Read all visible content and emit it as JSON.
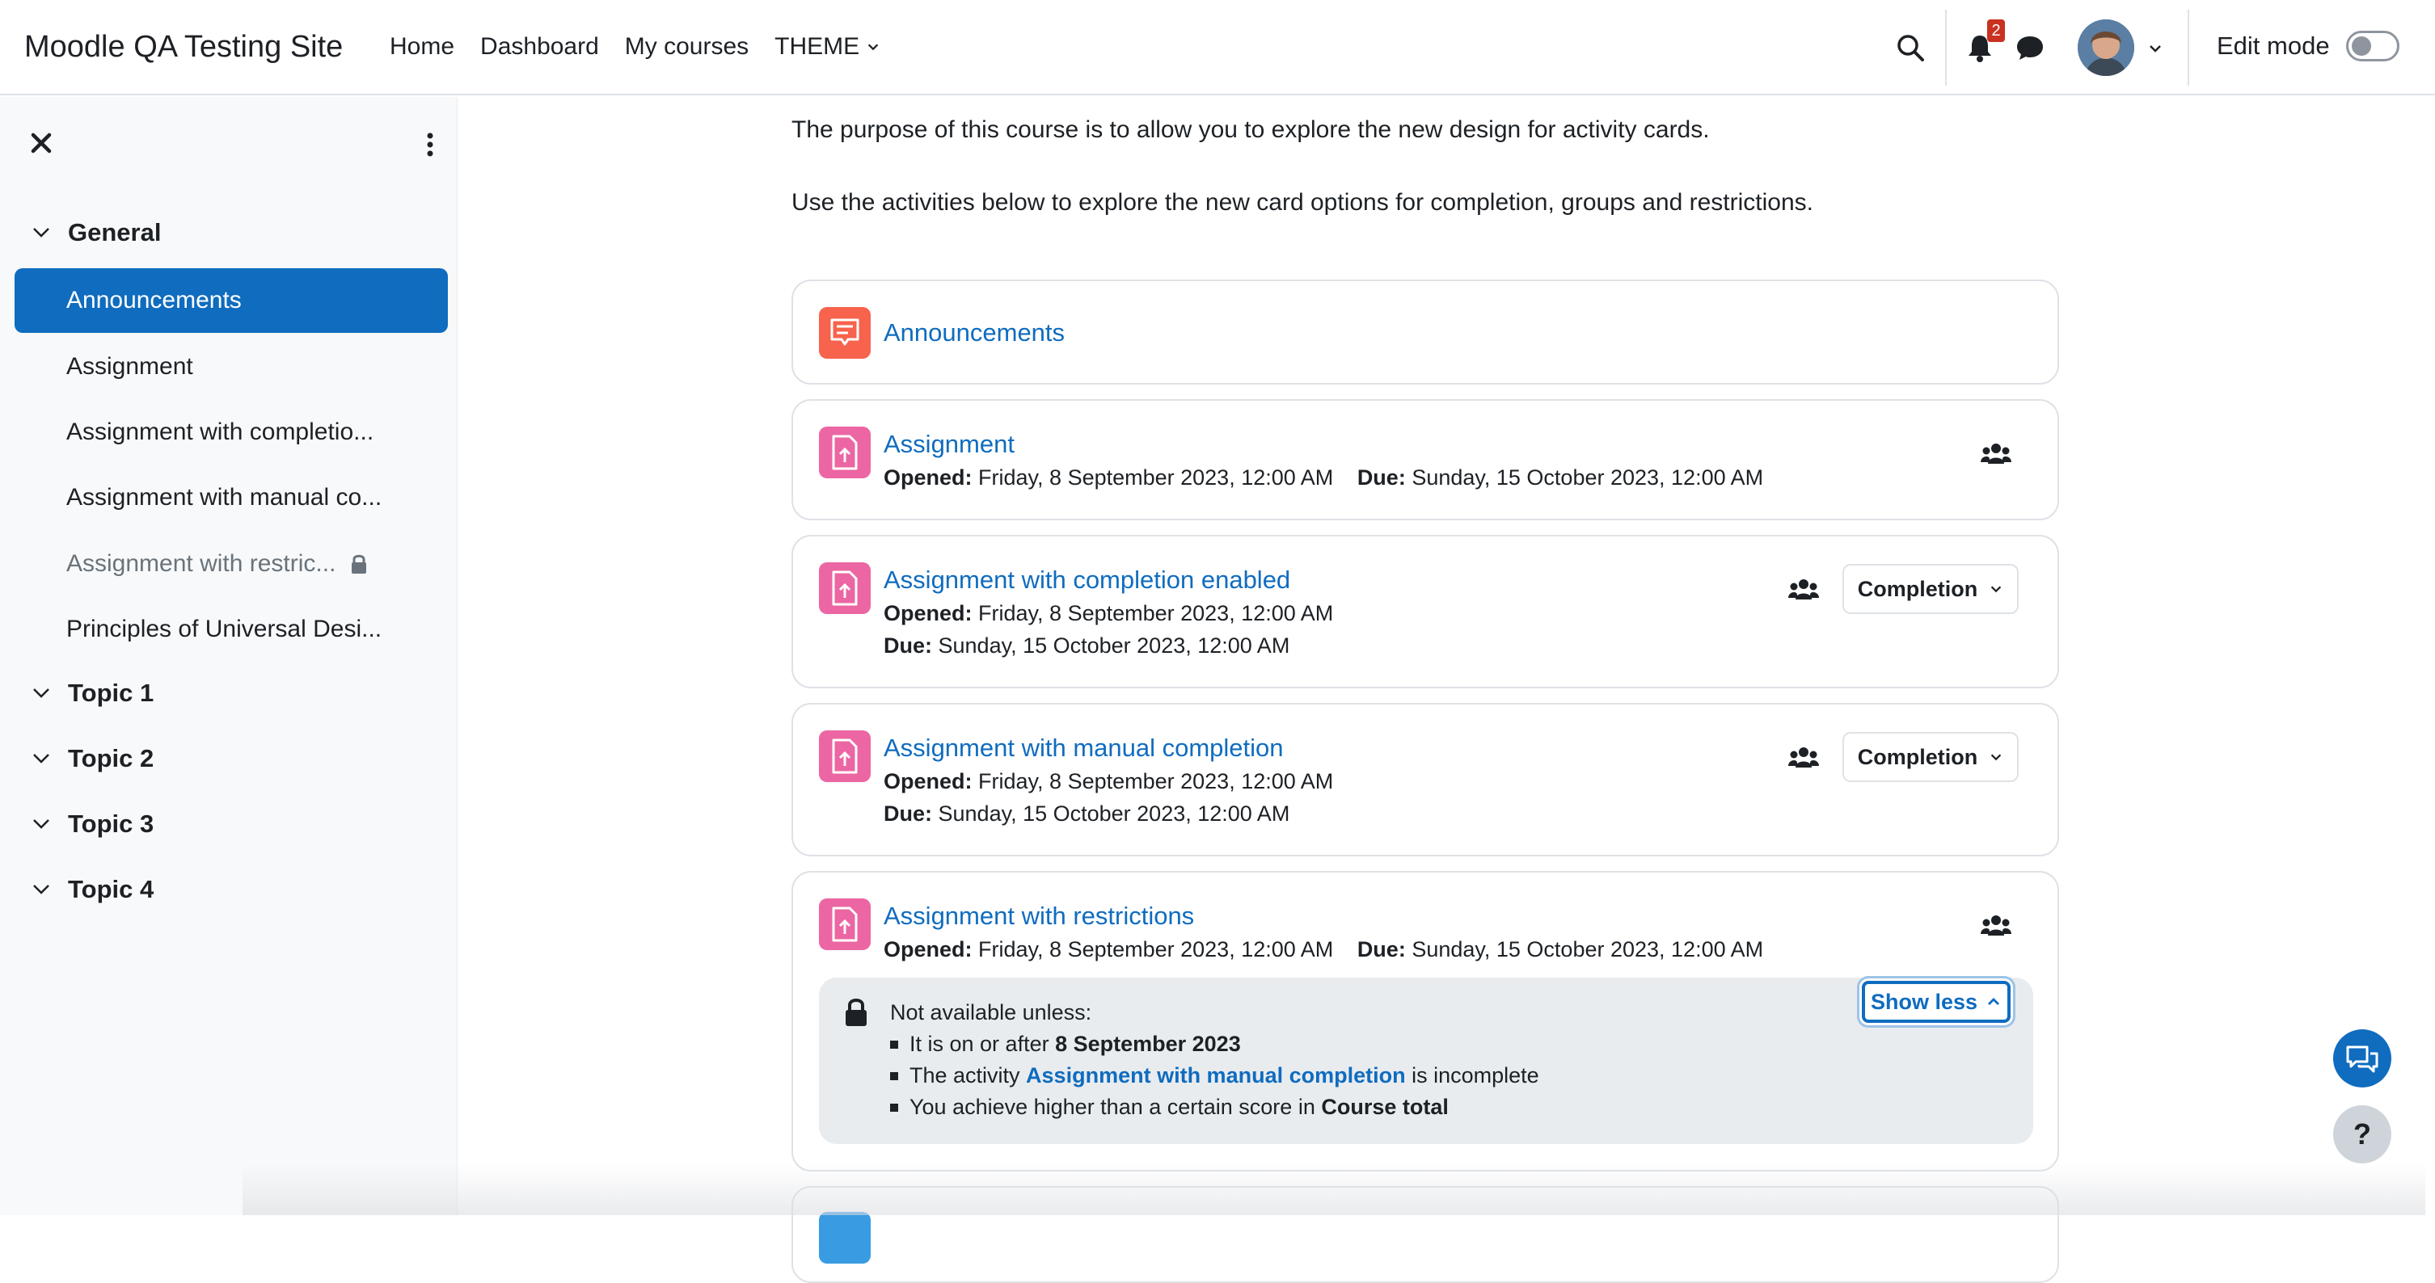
{
  "navbar": {
    "site_name": "Moodle QA Testing Site",
    "links": [
      "Home",
      "Dashboard",
      "My courses",
      "THEME"
    ],
    "notification_count": "2",
    "edit_mode_label": "Edit mode"
  },
  "drawer": {
    "sections": [
      {
        "title": "General",
        "items": [
          {
            "label": "Announcements",
            "active": true
          },
          {
            "label": "Assignment"
          },
          {
            "label": "Assignment with completio..."
          },
          {
            "label": "Assignment with manual co..."
          },
          {
            "label": "Assignment with restric...",
            "restricted": true
          },
          {
            "label": "Principles of Universal Desi..."
          }
        ]
      },
      {
        "title": "Topic 1"
      },
      {
        "title": "Topic 2"
      },
      {
        "title": "Topic 3"
      },
      {
        "title": "Topic 4"
      }
    ]
  },
  "main": {
    "intro": [
      "The purpose of this course is to allow you to explore the new design for activity cards.",
      "Use the activities below to explore the new card options for completion, groups and restrictions."
    ],
    "activities": [
      {
        "title": "Announcements",
        "icon": "forum-icon"
      },
      {
        "title": "Assignment",
        "opened_label": "Opened:",
        "opened": "Friday, 8 September 2023, 12:00 AM",
        "due_label": "Due:",
        "due": "Sunday, 15 October 2023, 12:00 AM"
      },
      {
        "title": "Assignment with completion enabled",
        "opened_label": "Opened:",
        "opened": "Friday, 8 September 2023, 12:00 AM",
        "due_label": "Due:",
        "due": "Sunday, 15 October 2023, 12:00 AM",
        "completion_label": "Completion"
      },
      {
        "title": "Assignment with manual completion",
        "opened_label": "Opened:",
        "opened": "Friday, 8 September 2023, 12:00 AM",
        "due_label": "Due:",
        "due": "Sunday, 15 October 2023, 12:00 AM",
        "completion_label": "Completion"
      },
      {
        "title": "Assignment with restrictions",
        "opened_label": "Opened:",
        "opened": "Friday, 8 September 2023, 12:00 AM",
        "due_label": "Due:",
        "due": "Sunday, 15 October 2023, 12:00 AM",
        "restriction": {
          "heading": "Not available unless:",
          "r1_pre": "It is on or after ",
          "r1_bold": "8 September 2023",
          "r2_pre": "The activity ",
          "r2_link": "Assignment with manual completion",
          "r2_post": " is incomplete",
          "r3_pre": "You achieve higher than a certain score in ",
          "r3_bold": "Course total",
          "toggle_label": "Show less"
        }
      }
    ]
  },
  "help_label": "?"
}
